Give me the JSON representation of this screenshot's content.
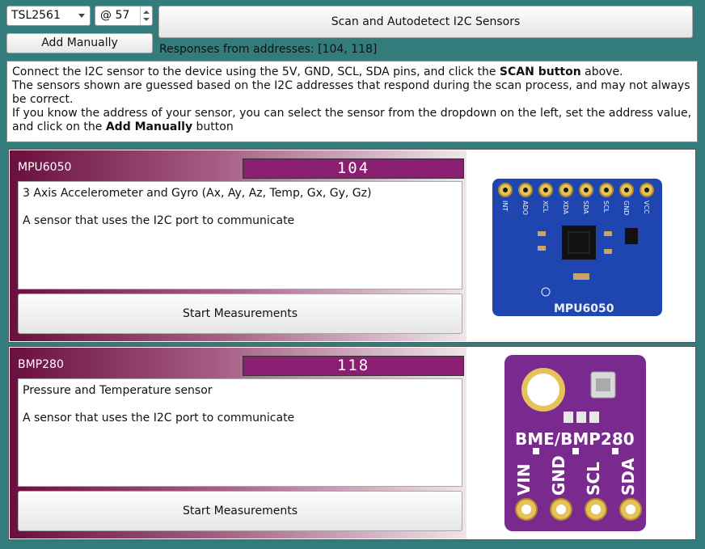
{
  "toolbar": {
    "sensor_select": "TSL2561",
    "address_value": "@ 57",
    "scan_label": "Scan and Autodetect I2C Sensors",
    "add_manually_label": "Add Manually",
    "responses": "Responses from addresses: [104, 118]"
  },
  "info": {
    "line1_a": "Connect the I2C sensor to the device using the 5V, GND, SCL, SDA pins, and click the ",
    "line1_b": "SCAN button",
    "line1_c": " above.",
    "line2": "The sensors shown are guessed based on the I2C addresses that respond during the scan process, and may not always be correct.",
    "line3_a": "If you know the address of your sensor, you can select the sensor from the dropdown on the left, set the address value, and click on the ",
    "line3_b": "Add Manually",
    "line3_c": " button"
  },
  "sensors": [
    {
      "name": "MPU6050",
      "address": "104",
      "desc1": "3 Axis Accelerometer and Gyro (Ax, Ay, Az, Temp, Gx, Gy, Gz)",
      "desc2": "A sensor that uses the I2C port to communicate",
      "start_label": "Start Measurements",
      "board": {
        "pins": [
          "INT",
          "ADO",
          "XCL",
          "XDA",
          "SDA",
          "SCL",
          "GND",
          "VCC"
        ],
        "silk": "MPU6050",
        "color": "#1f45b0"
      }
    },
    {
      "name": "BMP280",
      "address": "118",
      "desc1": "Pressure and Temperature sensor",
      "desc2": "A sensor that uses the I2C port to communicate",
      "start_label": "Start Measurements",
      "board": {
        "title": "BME/BMP280",
        "pins": [
          "VIN",
          "GND",
          "SCL",
          "SDA"
        ],
        "color": "#7a2a8e"
      }
    }
  ],
  "colors": {
    "background": "#337c7b",
    "card_gradient_start": "#6a0f3e",
    "lcd": "#8a1f72"
  }
}
